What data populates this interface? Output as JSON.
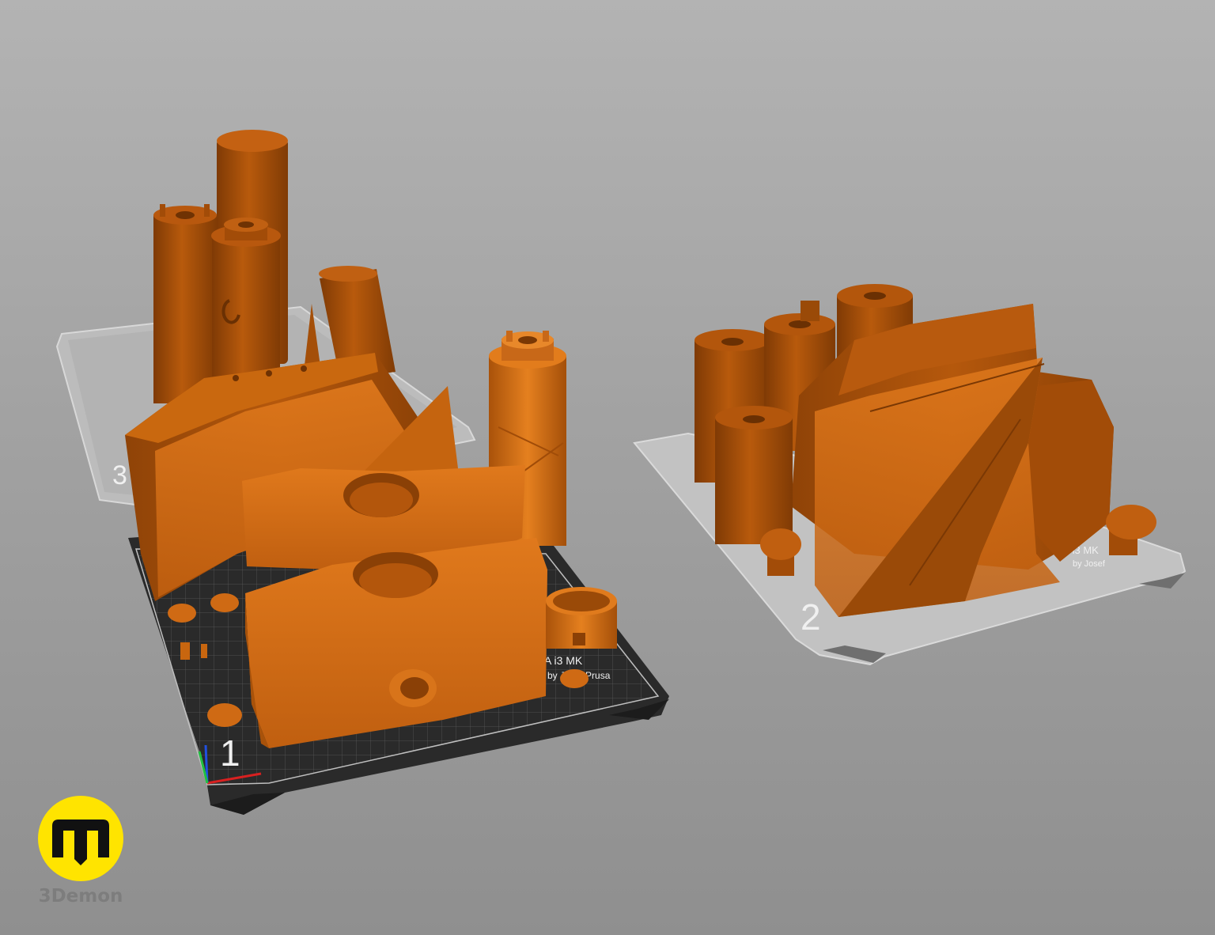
{
  "app": {
    "watermark": "3Demon",
    "logo_glyph": "m",
    "logo_icon": "3demon-logo-icon"
  },
  "colors": {
    "background_top": "#b3b3b3",
    "background_bottom": "#8f8f8f",
    "model_orange": "#c86412",
    "model_dark": "#9a4a08",
    "active_bed": "#2e2e2e",
    "inactive_bed": "#bdbdbd",
    "logo_yellow": "#ffe400"
  },
  "beds": [
    {
      "id": "bed-1",
      "number": "1",
      "label_line1": "A i3 MK",
      "label_line2": "by Josef Prusa",
      "active": true
    },
    {
      "id": "bed-2",
      "number": "2",
      "label_line1": "USA i3 MK",
      "label_line2": "by Josef",
      "active": false
    },
    {
      "id": "bed-3",
      "number": "3",
      "active": false
    }
  ]
}
